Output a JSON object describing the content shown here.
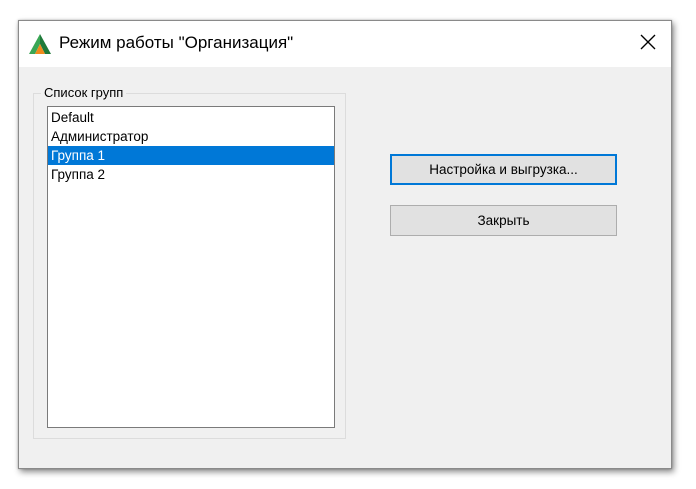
{
  "window": {
    "title": "Режим работы \"Организация\"",
    "icon": "app-logo-icon",
    "close_icon": "close-icon"
  },
  "groups_panel": {
    "label": "Список групп",
    "items": [
      {
        "label": "Default",
        "selected": false
      },
      {
        "label": "Администратор",
        "selected": false
      },
      {
        "label": "Группа 1",
        "selected": true
      },
      {
        "label": "Группа 2",
        "selected": false
      }
    ]
  },
  "buttons": {
    "configure_label": "Настройка и выгрузка...",
    "close_label": "Закрыть"
  },
  "colors": {
    "selection": "#0078d7",
    "dialog_bg": "#f0f0f0",
    "logo_green": "#3aa655",
    "logo_orange": "#f08a1c"
  }
}
